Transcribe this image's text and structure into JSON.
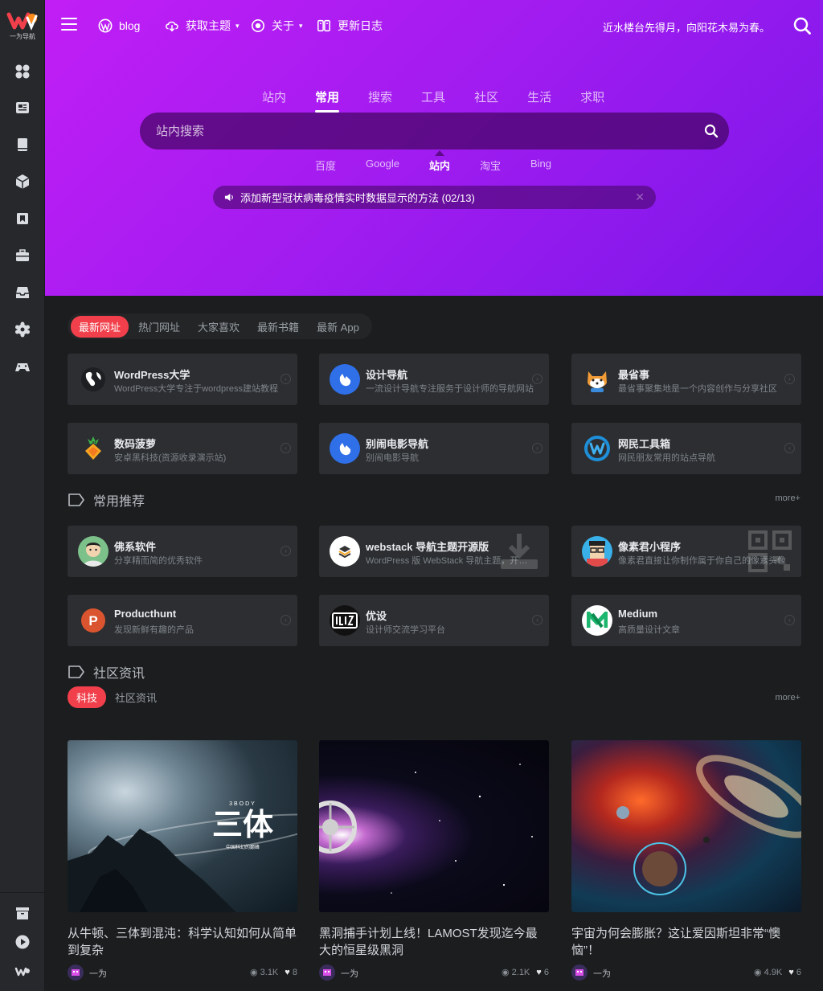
{
  "sidebar": {
    "logo_text": "一为导航",
    "icons": [
      "grid-icon",
      "news-icon",
      "book-icon",
      "box-icon",
      "bookmark-icon",
      "toolbox-icon",
      "inbox-icon",
      "settings-icon",
      "gamepad-icon"
    ],
    "bottom_icons": [
      "archive-icon",
      "play-icon",
      "brand-icon"
    ]
  },
  "header": {
    "nav": [
      {
        "label": "blog",
        "icon": "wordpress-icon"
      },
      {
        "label": "获取主题",
        "icon": "download-cloud-icon",
        "caret": "▾"
      },
      {
        "label": "关于",
        "icon": "about-icon",
        "caret": "▾"
      },
      {
        "label": "更新日志",
        "icon": "changelog-icon"
      }
    ],
    "slogan": "近水楼台先得月，向阳花木易为春。"
  },
  "search": {
    "tabs": [
      "站内",
      "常用",
      "搜索",
      "工具",
      "社区",
      "生活",
      "求职"
    ],
    "active_tab": 1,
    "placeholder": "站内搜索",
    "engines": [
      "百度",
      "Google",
      "站内",
      "淘宝",
      "Bing"
    ],
    "active_engine": 2
  },
  "notice": {
    "text": "添加新型冠状病毒疫情实时数据显示的方法 (02/13)",
    "close": "✕"
  },
  "filter_pills": [
    "最新网址",
    "热门网址",
    "大家喜欢",
    "最新书籍",
    "最新 App"
  ],
  "latest_sites": [
    {
      "title": "WordPress大学",
      "desc": "WordPress大学专注于wordpress建站教程",
      "avatar": "wp-globe"
    },
    {
      "title": "设计导航",
      "desc": "一流设计导航专注服务于设计师的导航网站",
      "avatar": "blue-hand"
    },
    {
      "title": "最省事",
      "desc": "最省事聚集地是一个内容创作与分享社区",
      "avatar": "shiba"
    },
    {
      "title": "数码菠萝",
      "desc": "安卓黑科技(资源收录演示站)",
      "avatar": "pineapple"
    },
    {
      "title": "别闹电影导航",
      "desc": "别闹电影导航",
      "avatar": "blue-hand"
    },
    {
      "title": "网民工具箱",
      "desc": "网民朋友常用的站点导航",
      "avatar": "w-logo"
    }
  ],
  "recommend": {
    "title": "常用推荐",
    "more": "more+",
    "items": [
      {
        "title": "佛系软件",
        "desc": "分享精而简的优秀软件",
        "avatar": "buddha"
      },
      {
        "title": "webstack 导航主题开源版",
        "desc": "WordPress 版 WebStack 导航主题，开源免费",
        "avatar": "layers"
      },
      {
        "title": "像素君小程序",
        "desc": "像素君直接让你制作属于你自己的像素头像",
        "avatar": "pixel-face"
      },
      {
        "title": "Producthunt",
        "desc": "发现新鲜有趣的产品",
        "avatar": "ph"
      },
      {
        "title": "优设",
        "desc": "设计师交流学习平台",
        "avatar": "uisdc"
      },
      {
        "title": "Medium",
        "desc": "高质量设计文章",
        "avatar": "medium"
      }
    ]
  },
  "community": {
    "title": "社区资讯",
    "more": "more+",
    "pills": [
      "科技",
      "社区资讯"
    ],
    "posts": [
      {
        "title": "从牛顿、三体到混沌：科学认知如何从简单到复杂",
        "author": "一为",
        "views": "3.1K",
        "likes": "8",
        "image_caption_top": "3BODY",
        "image_caption": "三体",
        "image_caption_sub": "中国科幻的巅峰"
      },
      {
        "title": "黑洞捕手计划上线！LAMOST发现迄今最大的恒星级黑洞",
        "author": "一为",
        "views": "2.1K",
        "likes": "6"
      },
      {
        "title": "宇宙为何会膨胀？这让爱因斯坦非常“懊恼”！",
        "author": "一为",
        "views": "4.9K",
        "likes": "6"
      }
    ]
  },
  "colors": {
    "accent": "#f1404b",
    "hero_start": "#c11ef5",
    "hero_end": "#7b17ea",
    "bg": "#1b1d1f",
    "card": "#2c2e31"
  }
}
